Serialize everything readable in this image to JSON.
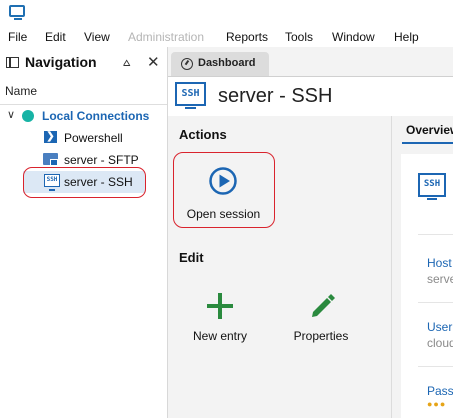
{
  "menubar": {
    "items": [
      {
        "label": "File",
        "enabled": true
      },
      {
        "label": "Edit",
        "enabled": true
      },
      {
        "label": "View",
        "enabled": true
      },
      {
        "label": "Administration",
        "enabled": false
      },
      {
        "label": "Reports",
        "enabled": true
      },
      {
        "label": "Tools",
        "enabled": true
      },
      {
        "label": "Window",
        "enabled": true
      },
      {
        "label": "Help",
        "enabled": true
      }
    ]
  },
  "navigation": {
    "title": "Navigation",
    "column_header": "Name",
    "tree": {
      "root": {
        "label": "Local Connections",
        "expanded": true
      },
      "children": [
        {
          "label": "Powershell",
          "icon": "powershell-icon"
        },
        {
          "label": "server -  SFTP",
          "icon": "sftp-icon"
        },
        {
          "label": "server - SSH",
          "icon": "ssh-icon",
          "selected": true
        }
      ]
    }
  },
  "tabs": [
    {
      "label": "Dashboard",
      "icon": "gauge-icon",
      "active": true
    }
  ],
  "entry": {
    "title": "server - SSH",
    "badge": "SSH"
  },
  "actions": {
    "title": "Actions",
    "items": [
      {
        "label": "Open session",
        "icon": "play-circle-icon"
      }
    ]
  },
  "edit": {
    "title": "Edit",
    "items": [
      {
        "label": "New entry",
        "icon": "plus-icon"
      },
      {
        "label": "Properties",
        "icon": "pencil-icon"
      }
    ]
  },
  "overview": {
    "tab_label": "Overview",
    "badge": "SSH",
    "fields": [
      {
        "key": "Host",
        "value": "serve"
      },
      {
        "key": "User",
        "value": "cloud"
      },
      {
        "key": "Pass",
        "value": "●●●"
      }
    ]
  },
  "colors": {
    "accent_blue": "#1c66b3",
    "highlight_red": "#d9232d",
    "connection_teal": "#17b3a5",
    "plus_green": "#2a8a3e"
  }
}
